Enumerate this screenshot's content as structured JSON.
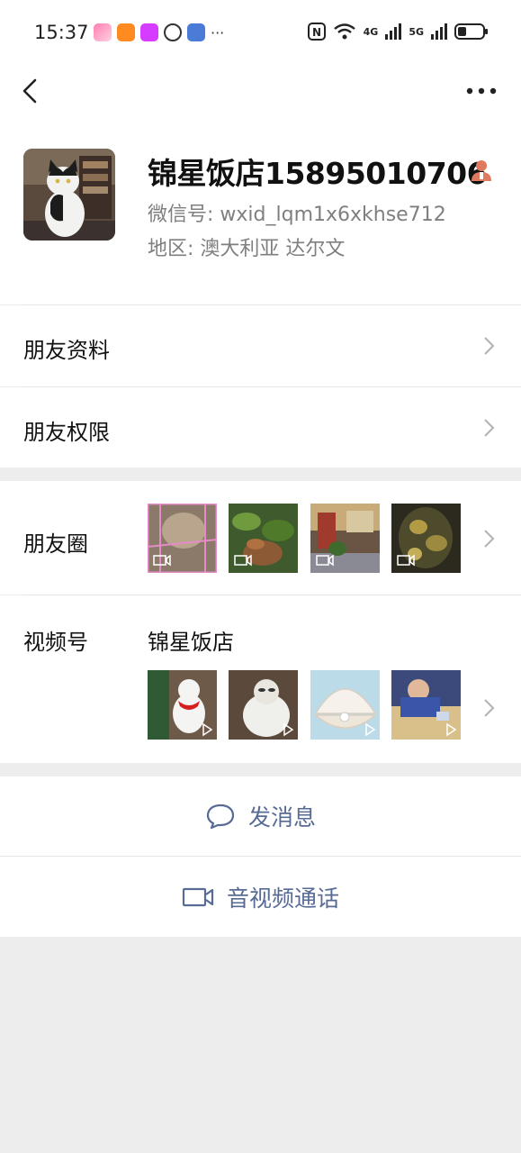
{
  "status_bar": {
    "time": "15:37",
    "more": "···",
    "net_4g": "4G",
    "net_5g": "5G"
  },
  "nav": {
    "back_icon": "chevron-left-icon",
    "more_icon": "more-horizontal-icon"
  },
  "profile": {
    "name": "锦星饭店15895010706",
    "wechat_id": "微信号: wxid_lqm1x6xkhse712",
    "region": "地区: 澳大利亚  达尔文"
  },
  "menu": {
    "friend_info": "朋友资料",
    "friend_permissions": "朋友权限",
    "moments": "朋友圈",
    "channels": "视频号",
    "channels_name": "锦星饭店"
  },
  "actions": {
    "send_message": "发消息",
    "video_call": "音视频通话"
  },
  "colors": {
    "link_blue": "#576b95",
    "contact_icon": "#e07a5f"
  }
}
